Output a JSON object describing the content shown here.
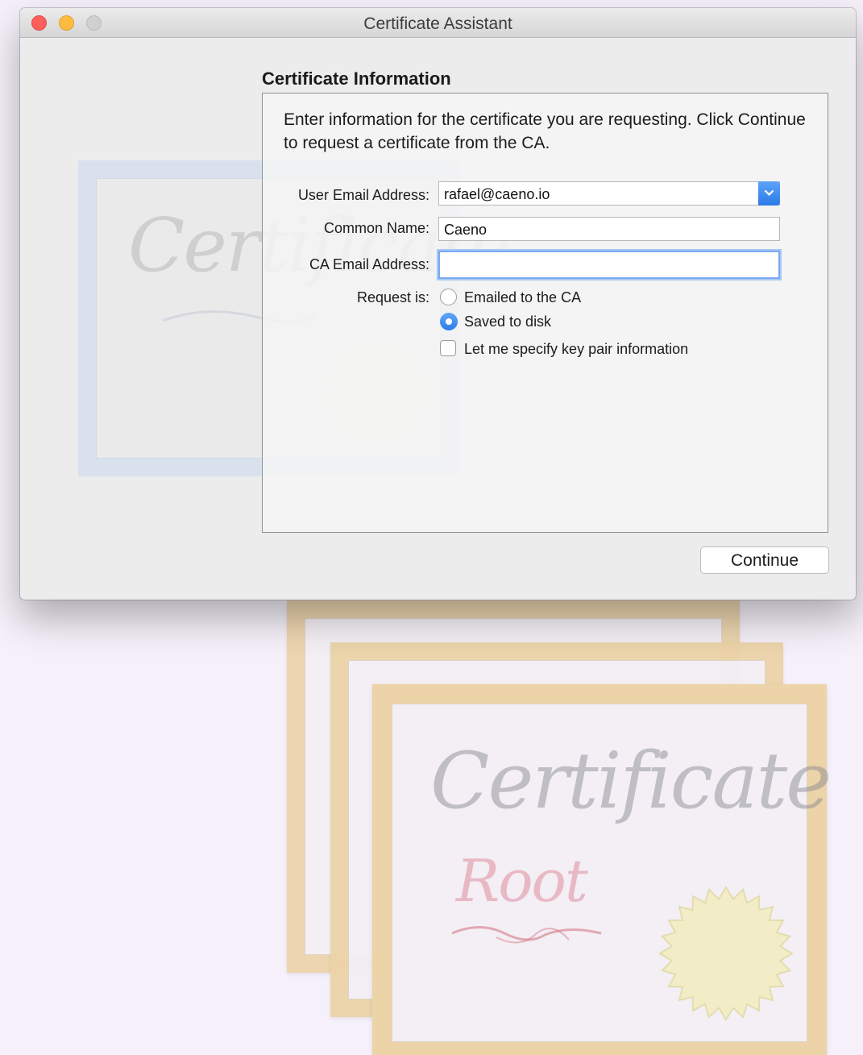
{
  "window": {
    "title": "Certificate Assistant"
  },
  "section_title": "Certificate Information",
  "intro": "Enter information for the certificate you are requesting. Click Continue to request a certificate from the CA.",
  "form": {
    "user_email_label": "User Email Address:",
    "user_email_value": "rafael@caeno.io",
    "common_name_label": "Common Name:",
    "common_name_value": "Caeno",
    "ca_email_label": "CA Email Address:",
    "ca_email_value": "",
    "request_label": "Request is:",
    "options": [
      {
        "label": "Emailed to the CA",
        "selected": false
      },
      {
        "label": "Saved to disk",
        "selected": true
      }
    ],
    "key_pair_label": "Let me specify key pair information",
    "key_pair_checked": false
  },
  "buttons": {
    "continue": "Continue"
  },
  "background": {
    "cert_word": "Certificate",
    "root_word": "Root"
  },
  "colors": {
    "accent": "#2c7ce8",
    "close": "#fc605b",
    "minimize": "#fdbc40",
    "zoom": "#d0d0d0",
    "cert_frame": "#ecd3a8"
  }
}
